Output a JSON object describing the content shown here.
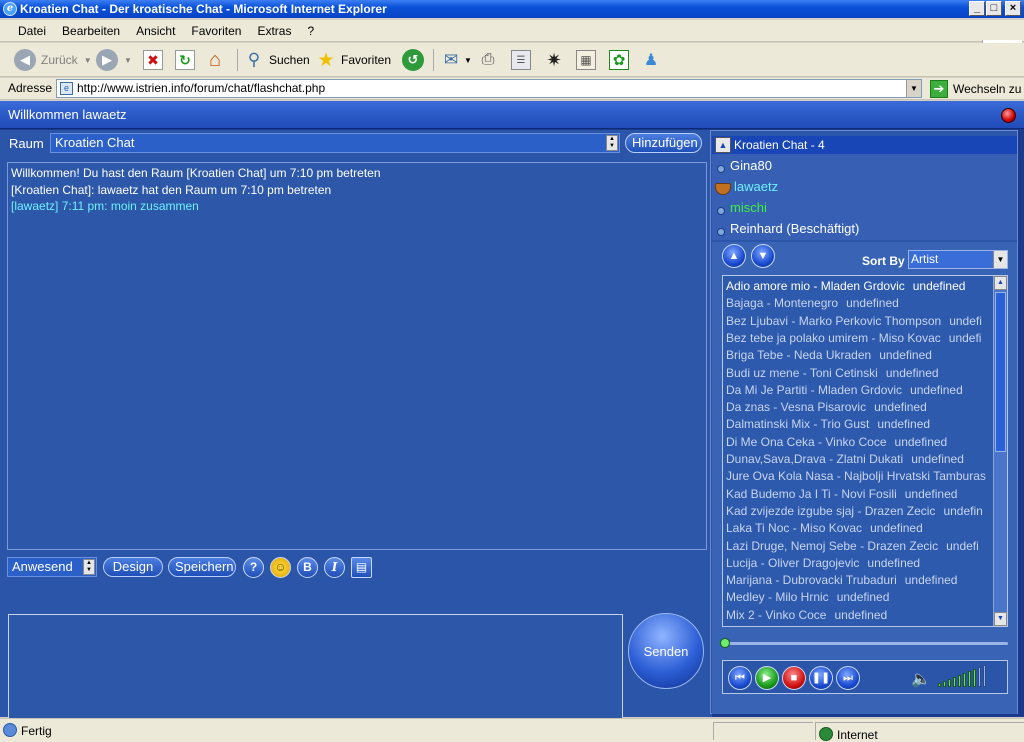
{
  "window": {
    "title": "Kroatien Chat - Der kroatische Chat - Microsoft Internet Explorer",
    "controls": {
      "minimize": "_",
      "maximize": "□",
      "close": "×"
    }
  },
  "menu": {
    "items": [
      "Datei",
      "Bearbeiten",
      "Ansicht",
      "Favoriten",
      "Extras",
      "?"
    ]
  },
  "toolbar": {
    "back_label": "Zurück",
    "search_label": "Suchen",
    "favorites_label": "Favoriten"
  },
  "address": {
    "label": "Adresse",
    "url": "http://www.istrien.info/forum/chat/flashchat.php",
    "go_label": "Wechseln zu"
  },
  "chat": {
    "welcome": "Willkommen lawaetz",
    "room_label": "Raum",
    "room_value": "Kroatien Chat",
    "add_button": "Hinzufügen",
    "messages": [
      {
        "text": "Willkommen! Du hast den Raum [Kroatien Chat] um 7:10 pm betreten",
        "color": "#ffffff"
      },
      {
        "text": "[Kroatien Chat]: lawaetz hat den Raum um 7:10 pm betreten",
        "color": "#ffffff"
      },
      {
        "text": "[lawaetz] 7:11 pm: moin zusammen",
        "color": "#6ff0ff"
      }
    ],
    "status_select": "Anwesend",
    "design_button": "Design",
    "save_button": "Speichern",
    "help_button": "?",
    "bold_button": "B",
    "italic_button": "I",
    "send_button": "Senden"
  },
  "users": {
    "header": "Kroatien Chat - 4",
    "list": [
      {
        "name": "Gina80",
        "color": "#ffffff"
      },
      {
        "name": "lawaetz",
        "color": "#6ff0ff"
      },
      {
        "name": "mischi",
        "color": "#3cf03c"
      },
      {
        "name": "Reinhard (Beschäftigt)",
        "color": "#ffffff"
      }
    ]
  },
  "music": {
    "sort_label": "Sort By",
    "sort_value": "Artist",
    "progress": 0.0,
    "volume_level": 0.75,
    "songs": [
      {
        "title": "Adio amore mio - Mladen Grdovic",
        "info": "undefined"
      },
      {
        "title": "Bajaga - Montenegro",
        "info": "undefined"
      },
      {
        "title": "Bez Ljubavi - Marko Perkovic Thompson",
        "info": "undefi"
      },
      {
        "title": "Bez tebe ja polako umirem - Miso Kovac",
        "info": "undefi"
      },
      {
        "title": "Briga Tebe - Neda Ukraden",
        "info": "undefined"
      },
      {
        "title": "Budi uz mene - Toni Cetinski",
        "info": "undefined"
      },
      {
        "title": "Da Mi Je Partiti - Mladen Grdovic",
        "info": "undefined"
      },
      {
        "title": "Da znas - Vesna Pisarovic",
        "info": "undefined"
      },
      {
        "title": "Dalmatinski Mix - Trio Gust",
        "info": "undefined"
      },
      {
        "title": "Di Me Ona Ceka - Vinko Coce",
        "info": "undefined"
      },
      {
        "title": "Dunav,Sava,Drava - Zlatni Dukati",
        "info": "undefined"
      },
      {
        "title": "Jure Ova Kola Nasa - Najbolji Hrvatski Tamburas",
        "info": ""
      },
      {
        "title": "Kad Budemo Ja I Ti - Novi Fosili",
        "info": "undefined"
      },
      {
        "title": "Kad zvijezde izgube sjaj - Drazen Zecic",
        "info": "undefin"
      },
      {
        "title": "Laka Ti Noc - Miso Kovac",
        "info": "undefined"
      },
      {
        "title": "Lazi Druge, Nemoj Sebe - Drazen Zecic",
        "info": "undefi"
      },
      {
        "title": "Lucija - Oliver Dragojevic",
        "info": "undefined"
      },
      {
        "title": "Marijana - Dubrovacki Trubaduri",
        "info": "undefined"
      },
      {
        "title": "Medley - Milo Hrnic",
        "info": "undefined"
      },
      {
        "title": "Mix 2 - Vinko Coce",
        "info": "undefined"
      }
    ]
  },
  "status": {
    "left": "Fertig",
    "zone": "Internet"
  },
  "colors": {
    "chat_bg": "#2a55a8",
    "accent": "#1846b6"
  }
}
